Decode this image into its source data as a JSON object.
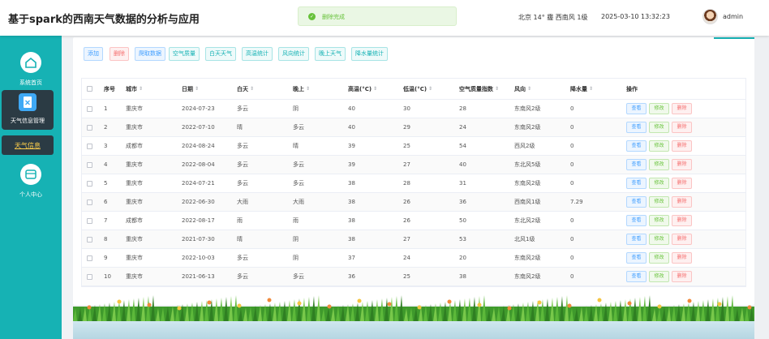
{
  "app": {
    "title": "基于spark的西南天气数据的分析与应用"
  },
  "toast": {
    "message": "删除完成"
  },
  "header": {
    "weather": "北京 14° 霾 西南风 1级",
    "datetime": "2025-03-10 13:32:23",
    "username": "admin"
  },
  "sidebar": {
    "items": [
      {
        "label": "系统首页",
        "icon": "home-icon"
      },
      {
        "label": "天气信息管理",
        "icon": "clipboard-icon"
      },
      {
        "label": "天气信息",
        "icon": ""
      },
      {
        "label": "个人中心",
        "icon": "wallet-icon"
      }
    ]
  },
  "toolbar": {
    "buttons": [
      "添加",
      "删除",
      "爬取数据",
      "空气质量",
      "白天天气",
      "高温统计",
      "风向统计",
      "晚上天气",
      "降水量统计"
    ]
  },
  "table": {
    "columns": [
      "序号",
      "城市",
      "日期",
      "白天",
      "晚上",
      "高温(°C)",
      "低温(°C)",
      "空气质量指数",
      "风向",
      "降水量",
      "操作"
    ],
    "actions": {
      "view": "查看",
      "edit": "修改",
      "delete": "删除"
    },
    "rows": [
      [
        "1",
        "重庆市",
        "2024-07-23",
        "多云",
        "阴",
        "40",
        "30",
        "28",
        "东南风2级",
        "0"
      ],
      [
        "2",
        "重庆市",
        "2022-07-10",
        "晴",
        "多云",
        "40",
        "29",
        "24",
        "东南风2级",
        "0"
      ],
      [
        "3",
        "成都市",
        "2024-08-24",
        "多云",
        "晴",
        "39",
        "25",
        "54",
        "西风2级",
        "0"
      ],
      [
        "4",
        "重庆市",
        "2022-08-04",
        "多云",
        "多云",
        "39",
        "27",
        "40",
        "东北风5级",
        "0"
      ],
      [
        "5",
        "重庆市",
        "2024-07-21",
        "多云",
        "多云",
        "38",
        "28",
        "31",
        "东南风2级",
        "0"
      ],
      [
        "6",
        "重庆市",
        "2022-06-30",
        "大雨",
        "大雨",
        "38",
        "26",
        "36",
        "西南风1级",
        "7.29"
      ],
      [
        "7",
        "成都市",
        "2022-08-17",
        "雨",
        "雨",
        "38",
        "26",
        "50",
        "东北风2级",
        "0"
      ],
      [
        "8",
        "重庆市",
        "2021-07-30",
        "晴",
        "阴",
        "38",
        "27",
        "53",
        "北风1级",
        "0"
      ],
      [
        "9",
        "重庆市",
        "2022-10-03",
        "多云",
        "阴",
        "37",
        "24",
        "20",
        "东南风2级",
        "0"
      ],
      [
        "10",
        "重庆市",
        "2021-06-13",
        "多云",
        "多云",
        "36",
        "25",
        "38",
        "东南风2级",
        "0"
      ]
    ]
  },
  "colors": {
    "sidebar": "#16b2b4",
    "active_nav": "#2b3b44",
    "sub_text": "#ffd04b",
    "view": "#409eff",
    "edit": "#67c23a",
    "delete": "#f56c6c"
  }
}
